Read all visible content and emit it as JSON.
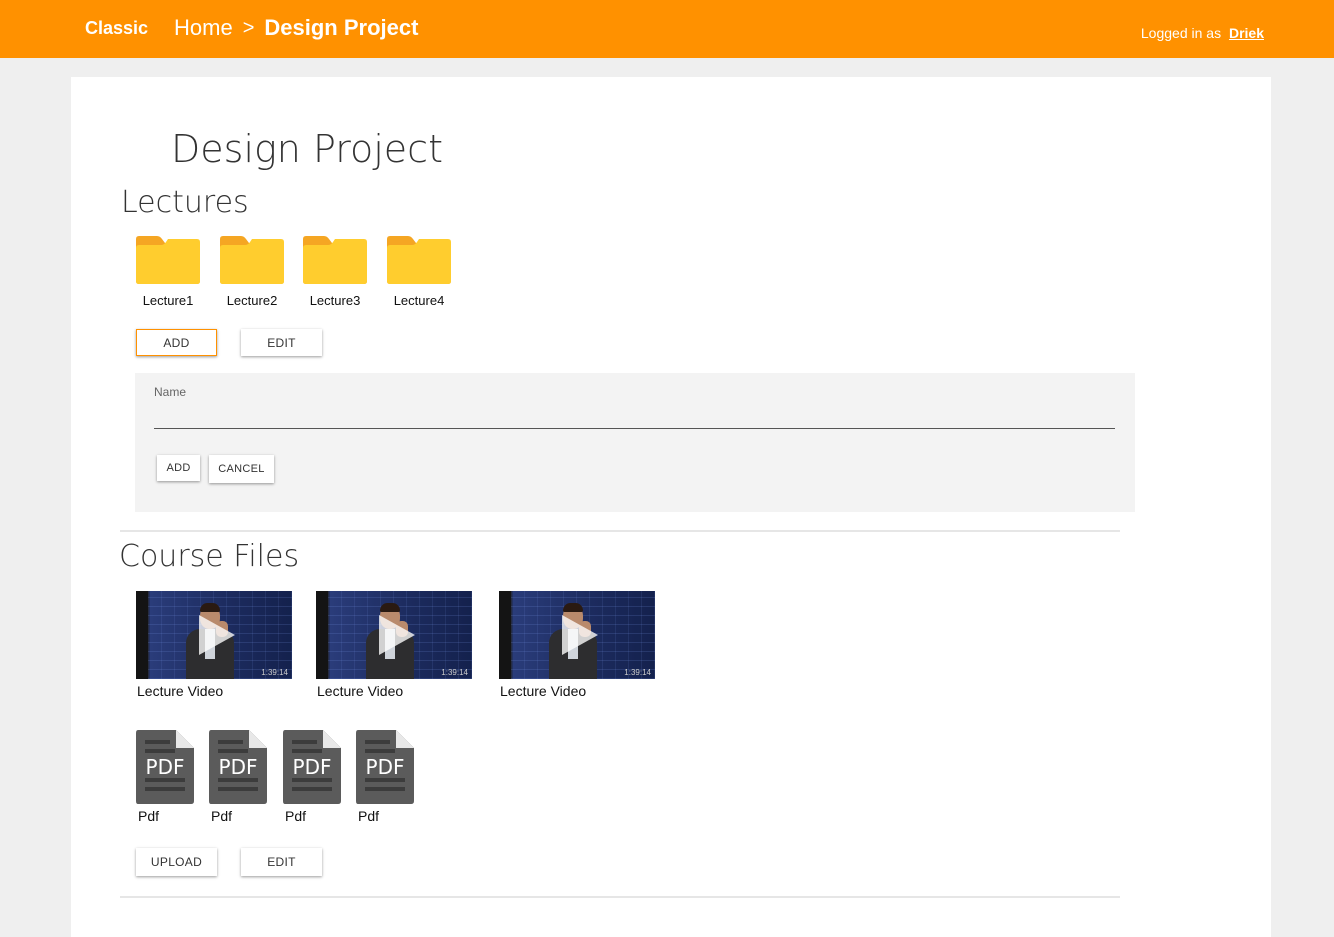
{
  "header": {
    "brand": "Classic",
    "breadcrumb_home": "Home",
    "breadcrumb_sep": ">",
    "breadcrumb_current": "Design Project",
    "login_prefix": "Logged in as",
    "login_user": "Driek",
    "accent_color": "#ff9100"
  },
  "page": {
    "title": "Design Project"
  },
  "lectures": {
    "title": "Lectures",
    "folders": [
      "Lecture1",
      "Lecture2",
      "Lecture3",
      "Lecture4"
    ],
    "add_label": "ADD",
    "edit_label": "EDIT",
    "form": {
      "name_label": "Name",
      "name_value": "",
      "add_label": "ADD",
      "cancel_label": "CANCEL"
    }
  },
  "course_files": {
    "title": "Course Files",
    "videos": [
      {
        "label": "Lecture Video",
        "duration": "1:39:14"
      },
      {
        "label": "Lecture Video",
        "duration": "1:39:14"
      },
      {
        "label": "Lecture Video",
        "duration": "1:39:14"
      }
    ],
    "pdfs": [
      {
        "label": "Pdf",
        "badge": "PDF"
      },
      {
        "label": "Pdf",
        "badge": "PDF"
      },
      {
        "label": "Pdf",
        "badge": "PDF"
      },
      {
        "label": "Pdf",
        "badge": "PDF"
      }
    ],
    "upload_label": "UPLOAD",
    "edit_label": "EDIT"
  },
  "icons": {
    "folder": "folder-icon",
    "video": "video-thumbnail",
    "play": "play-icon",
    "pdf": "pdf-file-icon"
  }
}
